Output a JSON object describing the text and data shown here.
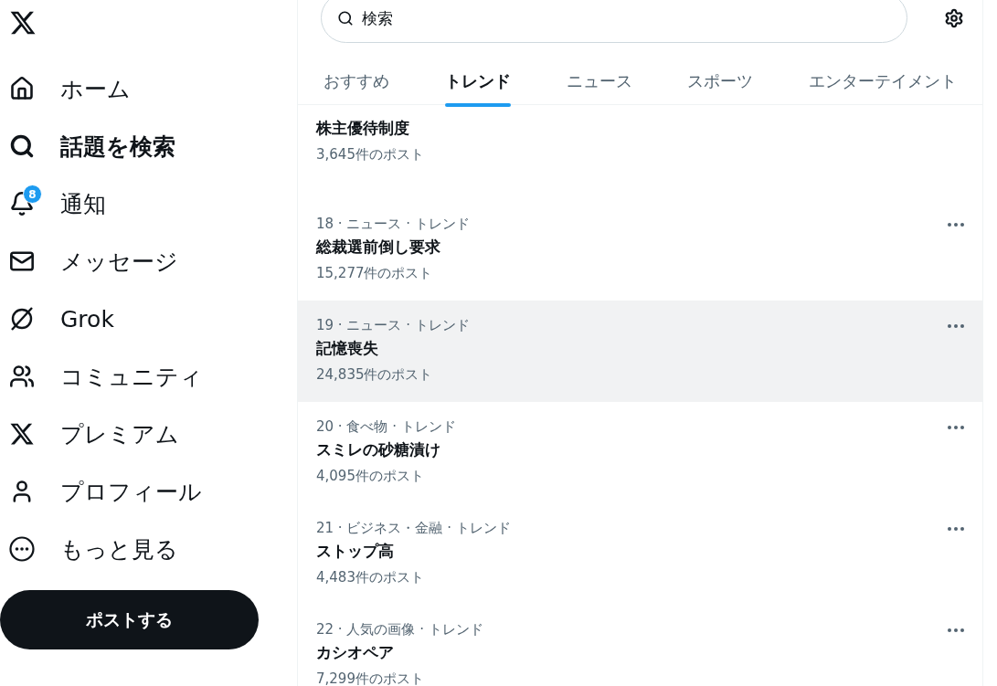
{
  "nav": {
    "items": [
      {
        "label": "ホーム",
        "kind": "home",
        "selected": false
      },
      {
        "label": "話題を検索",
        "kind": "search",
        "selected": true
      },
      {
        "label": "通知",
        "kind": "bell",
        "selected": false,
        "badge": "8"
      },
      {
        "label": "メッセージ",
        "kind": "mail",
        "selected": false
      },
      {
        "label": "Grok",
        "kind": "grok",
        "selected": false
      },
      {
        "label": "コミュニティ",
        "kind": "people",
        "selected": false
      },
      {
        "label": "プレミアム",
        "kind": "x",
        "selected": false
      },
      {
        "label": "プロフィール",
        "kind": "person",
        "selected": false
      },
      {
        "label": "もっと見る",
        "kind": "more",
        "selected": false
      }
    ],
    "post_button": "ポストする"
  },
  "search": {
    "placeholder": "検索"
  },
  "tabs": [
    {
      "label": "おすすめ",
      "selected": false
    },
    {
      "label": "トレンド",
      "selected": true
    },
    {
      "label": "ニュース",
      "selected": false
    },
    {
      "label": "スポーツ",
      "selected": false
    },
    {
      "label": "エンターテイメント",
      "selected": false
    }
  ],
  "trends": [
    {
      "name": "株主優待制度",
      "posts": "3,645件のポスト",
      "highlighted": false
    },
    {
      "category": "18 · ニュース · トレンド",
      "name": "総裁選前倒し要求",
      "posts": "15,277件のポスト",
      "highlighted": false
    },
    {
      "category": "19 · ニュース · トレンド",
      "name": "記憶喪失",
      "posts": "24,835件のポスト",
      "highlighted": true
    },
    {
      "category": "20 · 食べ物 · トレンド",
      "name": "スミレの砂糖漬け",
      "posts": "4,095件のポスト",
      "highlighted": false
    },
    {
      "category": "21 · ビジネス・金融 · トレンド",
      "name": "ストップ高",
      "posts": "4,483件のポスト",
      "highlighted": false
    },
    {
      "category": "22 · 人気の画像 · トレンド",
      "name": "カシオペア",
      "posts": "7,299件のポスト",
      "highlighted": false
    }
  ]
}
